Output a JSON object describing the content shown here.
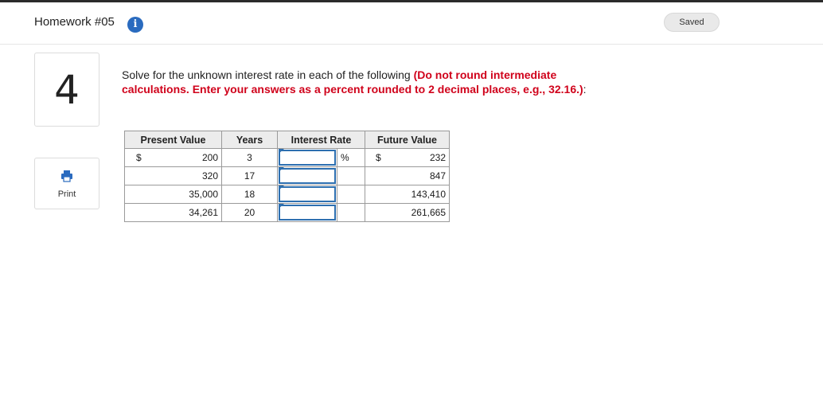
{
  "header": {
    "title": "Homework #05",
    "info_icon": "info-icon",
    "status": "Saved"
  },
  "question_number": "4",
  "print": {
    "label": "Print",
    "icon": "printer-icon"
  },
  "question": {
    "text": "Solve for the unknown interest rate in each of the following ",
    "instruction": "(Do not round intermediate calculations. Enter your answers as a percent rounded to 2 decimal places, e.g., 32.16.)",
    "suffix": ":"
  },
  "table": {
    "headers": [
      "Present Value",
      "Years",
      "Interest Rate",
      "Future Value"
    ],
    "currency": "$",
    "percent": "%",
    "rows": [
      {
        "present_value": "200",
        "years": "3",
        "interest_rate": "",
        "future_value": "232"
      },
      {
        "present_value": "320",
        "years": "17",
        "interest_rate": "",
        "future_value": "847"
      },
      {
        "present_value": "35,000",
        "years": "18",
        "interest_rate": "",
        "future_value": "143,410"
      },
      {
        "present_value": "34,261",
        "years": "20",
        "interest_rate": "",
        "future_value": "261,665"
      }
    ]
  },
  "colors": {
    "accent": "#2a6bbf",
    "instruction_red": "#d0021b",
    "input_border": "#2d6fb0"
  }
}
